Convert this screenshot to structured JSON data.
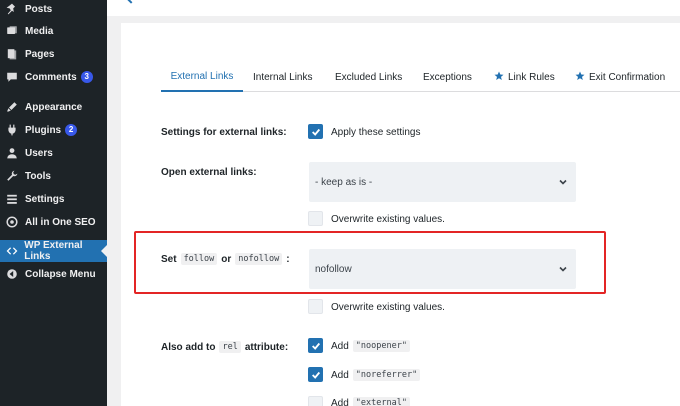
{
  "sidebar": {
    "items": [
      {
        "label": "Posts",
        "icon": "pin-icon"
      },
      {
        "label": "Media",
        "icon": "media-icon"
      },
      {
        "label": "Pages",
        "icon": "pages-icon"
      },
      {
        "label": "Comments",
        "icon": "comments-icon",
        "badge": "3"
      },
      {
        "label": "Appearance",
        "icon": "appearance-icon"
      },
      {
        "label": "Plugins",
        "icon": "plugins-icon",
        "badge": "2"
      },
      {
        "label": "Users",
        "icon": "users-icon"
      },
      {
        "label": "Tools",
        "icon": "tools-icon"
      },
      {
        "label": "Settings",
        "icon": "settings-icon"
      },
      {
        "label": "All in One SEO",
        "icon": "seo-icon"
      },
      {
        "label": "WP External Links",
        "icon": "code-icon",
        "active": true
      },
      {
        "label": "Collapse Menu",
        "icon": "collapse-icon"
      }
    ]
  },
  "tabs": [
    {
      "label": "External Links",
      "active": true
    },
    {
      "label": "Internal Links"
    },
    {
      "label": "Excluded Links"
    },
    {
      "label": "Exceptions"
    },
    {
      "label": "Link Rules",
      "icon": "star-icon"
    },
    {
      "label": "Exit Confirmation",
      "icon": "star-icon"
    }
  ],
  "settings": {
    "external_label": "Settings for external links:",
    "apply_label": "Apply these settings",
    "open_label": "Open external links:",
    "open_value": "- keep as is -",
    "overwrite_label": "Overwrite existing values.",
    "follow_label_prefix": "Set",
    "follow_code": "follow",
    "follow_or": "or",
    "nofollow_code": "nofollow",
    "follow_colon": ":",
    "follow_value": "nofollow",
    "rel_label_prefix": "Also add to",
    "rel_code": "rel",
    "rel_label_suffix": "attribute:",
    "add_word": "Add",
    "noopener": "\"noopener\"",
    "noreferrer": "\"noreferrer\"",
    "external": "\"external\""
  },
  "colors": {
    "sidebar_bg": "#1d2327",
    "accent": "#2271b1",
    "highlight": "#e32525"
  }
}
